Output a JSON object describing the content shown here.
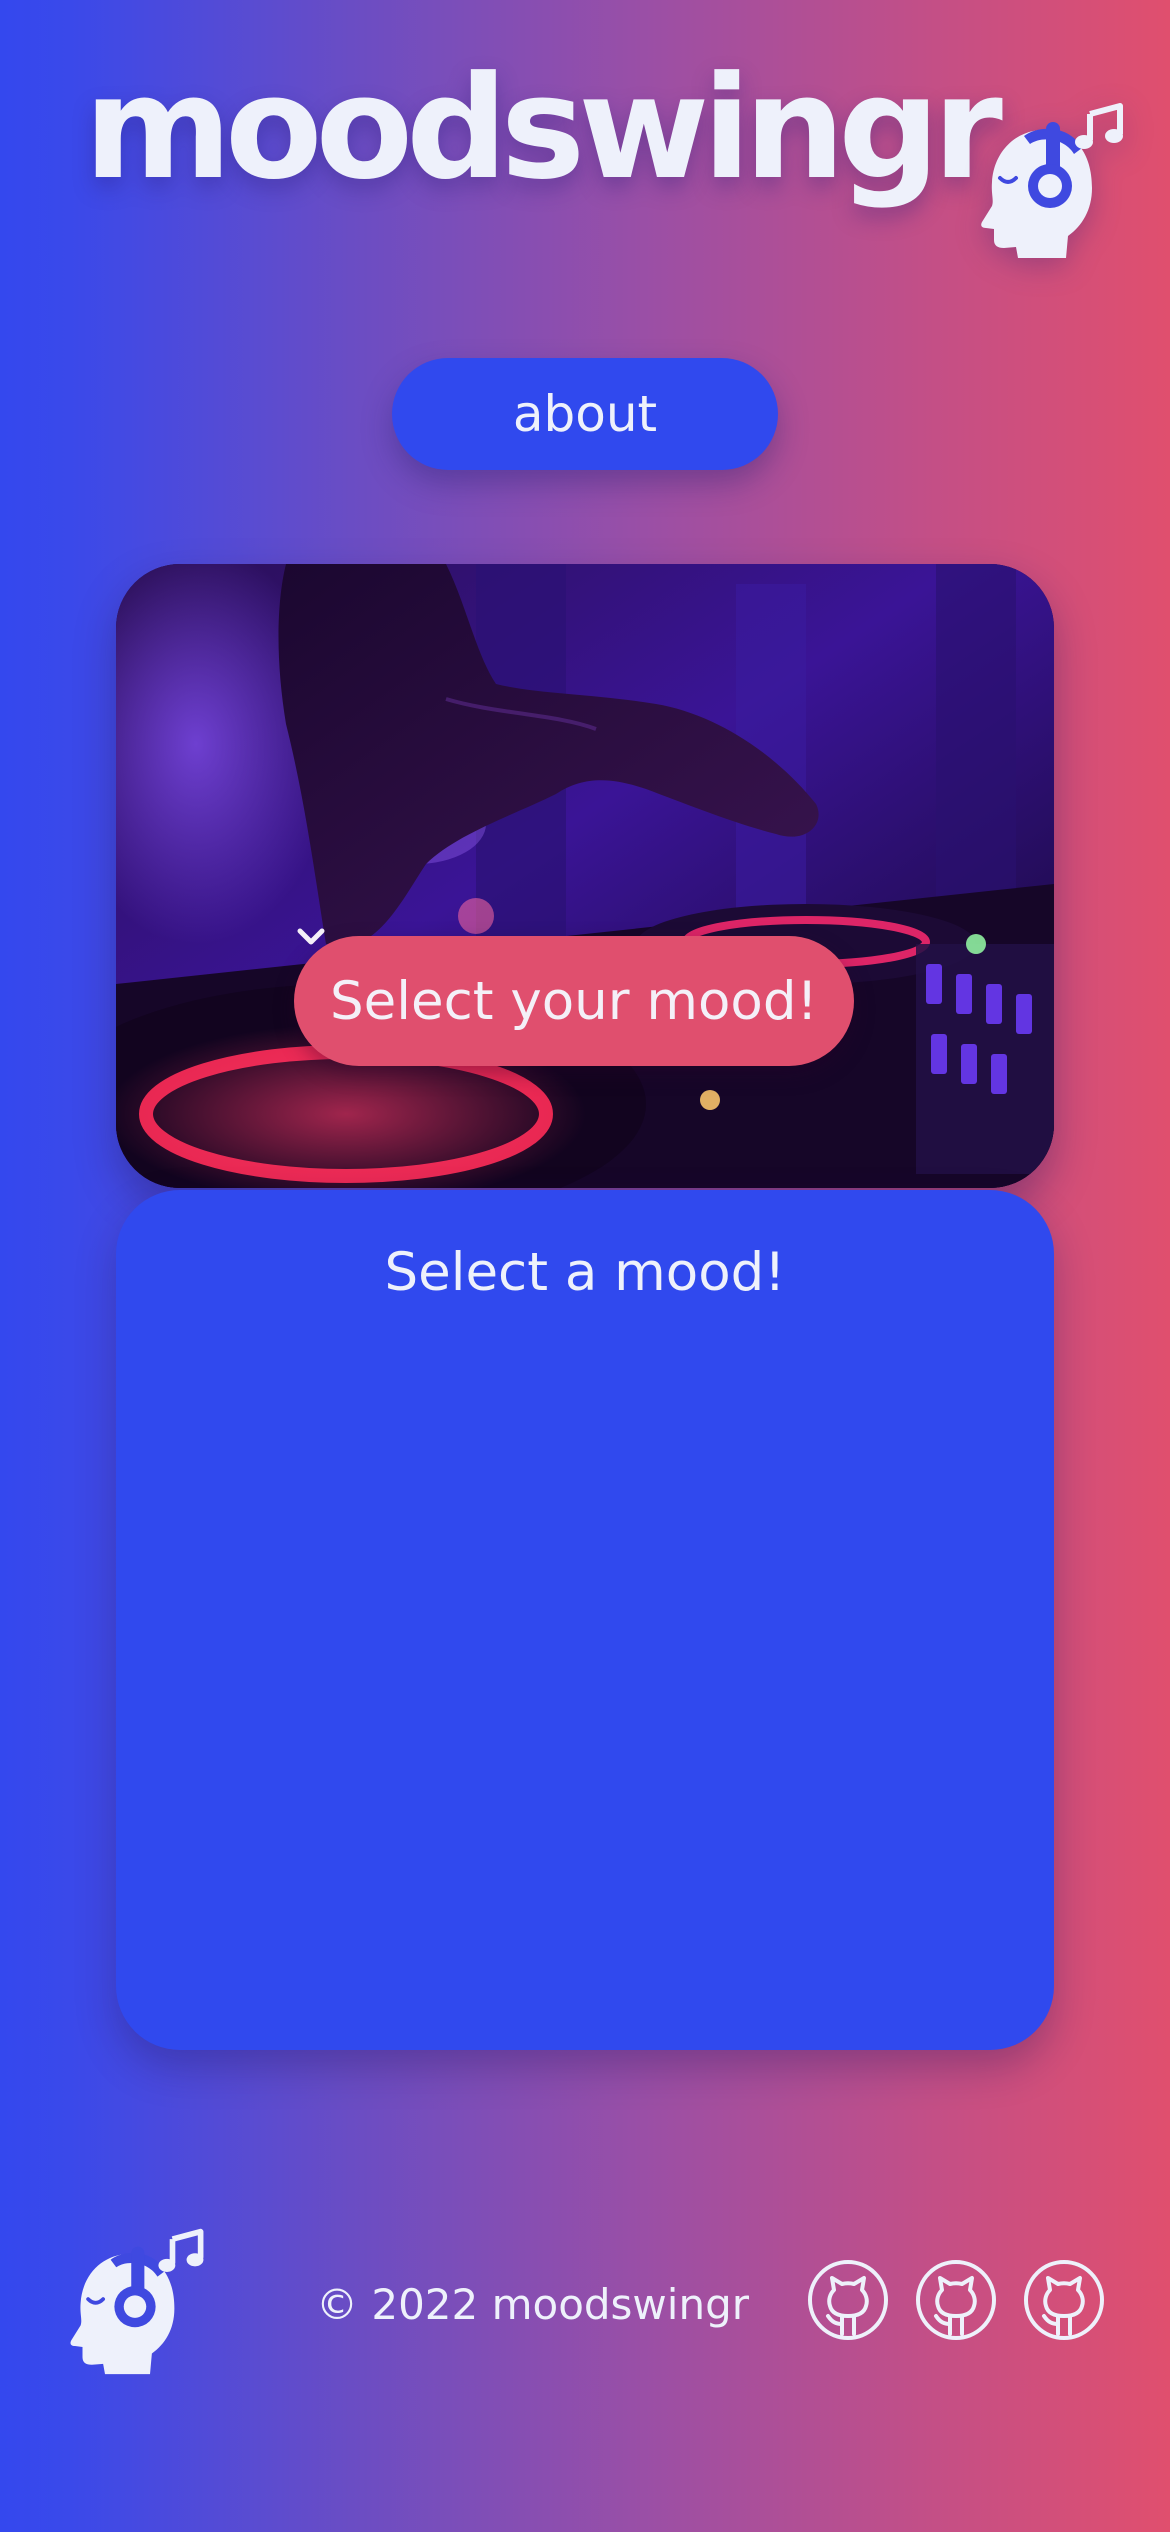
{
  "header": {
    "title": "moodswingr",
    "logo_icon": "headphones-head-icon"
  },
  "nav": {
    "about_label": "about"
  },
  "hero": {
    "image": "dj-turntable-photo",
    "mood_select": {
      "selected": "Select your mood!",
      "icon": "chevron-down-icon"
    }
  },
  "results": {
    "placeholder": "Select a mood!"
  },
  "footer": {
    "logo_icon": "headphones-head-icon",
    "copyright": "© 2022 moodswingr",
    "links": [
      {
        "icon": "github-icon"
      },
      {
        "icon": "github-icon"
      },
      {
        "icon": "github-icon"
      }
    ]
  },
  "colors": {
    "gradient_start": "#3448ee",
    "gradient_end": "#e04f6e",
    "button_blue": "#3049ee",
    "accent_pink": "#e04f6e",
    "text_light": "#eef1fb"
  }
}
